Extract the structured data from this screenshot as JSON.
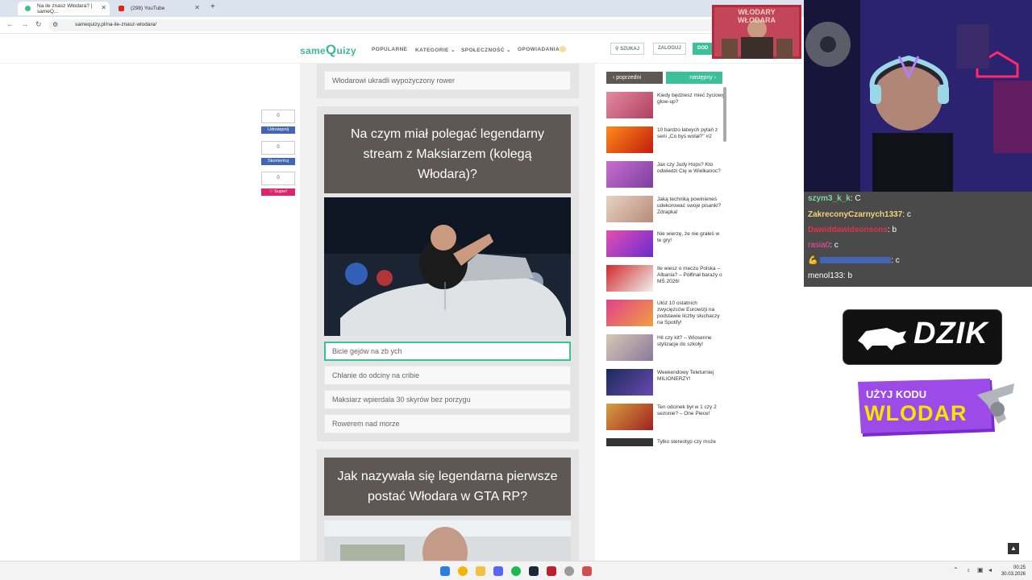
{
  "browser": {
    "tabs": [
      {
        "title": "Na ile znasz Włodara? | sameQ..."
      },
      {
        "title": "(298) YouTube"
      }
    ],
    "url": "samequizy.pl/na-ile-znasz-wlodara/"
  },
  "site": {
    "logo_prefix": "same",
    "logo_q": "Q",
    "logo_suffix": "uizy",
    "nav": [
      "POPULARNE",
      "KATEGORIE ⌄",
      "SPOŁECZNOŚĆ ⌄",
      "OPOWIADANIA"
    ],
    "search_label": "SZUKAJ",
    "login_label": "ZALOGUJ",
    "add_label": "DOD"
  },
  "share": {
    "count1": "0",
    "share_label": "Udostępnij",
    "count2": "0",
    "comment_label": "Skomentuj",
    "count3": "0",
    "super_label": "♡ Super!"
  },
  "quiz": {
    "prev_answer": "Włodarowi ukradli wypożyczony rower",
    "q1": {
      "question": "Na czym miał polegać legendarny stream z Maksiarzem (kolegą Włodara)?",
      "answers": [
        "Bicie gejów na zb  ych",
        "Chlanie do odciny na cribie",
        "Maksiarz wpierdala 30 skyrów bez porzygu",
        "Rowerem nad morze"
      ]
    },
    "q2": {
      "question": "Jak nazywała się legendarna pierwsze postać Włodara w GTA RP?"
    }
  },
  "sidebar": {
    "prev_label": "poprzedni",
    "next_label": "następny",
    "items": [
      {
        "text": "Kiedy będziesz mieć życiowy glow-up?"
      },
      {
        "text": "10 bardzo łatwych pytań z serii „Co byś wolał?\" #2"
      },
      {
        "text": "Jax czy Judy Hops? Kto odwiedzi Cię w Wielkanoc?"
      },
      {
        "text": "Jaką techniką powinieneś udekorować swoje pisanki? Zdrapka!"
      },
      {
        "text": "Nie wierzę, że nie grałeś w te gry!"
      },
      {
        "text": "Ile wiesz o meczu Polska – Albania? – Półfinał baraży o MŚ 2026!"
      },
      {
        "text": "Ułóż 10 ostatnich zwycięzców Eurowizji na podstawie liczby słuchaczy na Spotify!"
      },
      {
        "text": "Hit czy kit? – Wiosenne stylizacje do szkoły!"
      },
      {
        "text": "Weekendowy Teleturniej MILIONERZY!"
      },
      {
        "text": "Ten odcinek był w 1 czy 2 sezonie? – One Piece!"
      },
      {
        "text": "Tylko stereotyp czy może"
      }
    ]
  },
  "stream": {
    "banner_text": "WŁODARY WŁODARA",
    "chat": [
      {
        "user": "szym3_k_k",
        "msg": ": C",
        "color": "#7fd4a0"
      },
      {
        "user": "ZakreconyCzarnych1337",
        "msg": ": c",
        "color": "#f3d37a"
      },
      {
        "user": "Dawiddawidsonsons",
        "msg": ": b",
        "color": "#e0334a"
      },
      {
        "user": "rasia0",
        "msg": ": c",
        "color": "#ff4aa0"
      },
      {
        "user": "",
        "msg": ": c",
        "color": "#3f72e0"
      },
      {
        "user": "menol133",
        "msg": ": b",
        "color": "#ffffff"
      }
    ],
    "dzik_label": "DZIK",
    "code_line1": "UŻYJ KODU",
    "code_line2": "WLODAR"
  },
  "taskbar": {
    "time": "00:25",
    "date": "30.03.2026"
  }
}
